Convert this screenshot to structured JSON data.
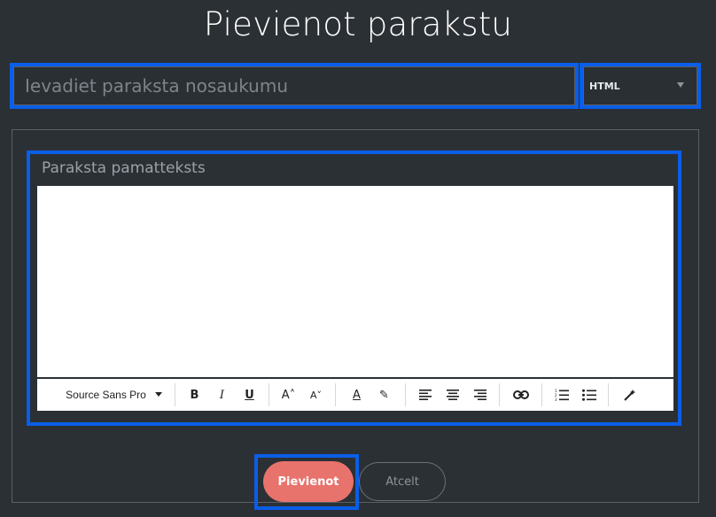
{
  "modal": {
    "title": "Pievienot parakstu",
    "name_placeholder": "Ievadiet paraksta nosaukumu",
    "name_value": "",
    "format_value": "HTML",
    "editor_label": "Paraksta pamatteksts",
    "toolbar": {
      "font_family": "Source Sans Pro",
      "bold": "B",
      "italic": "I",
      "underline": "U",
      "font_size_up": "A˄",
      "font_size_down": "A˅",
      "text_color": "A",
      "highlight": "✎",
      "align_left": "≡",
      "align_center": "≡",
      "align_right": "≡",
      "link": "⊂⊃",
      "ordered_list": "1≡",
      "unordered_list": "•≡",
      "clear_format": "✐"
    },
    "add_label": "Pievienot",
    "cancel_label": "Atcelt"
  },
  "colors": {
    "accent_border": "#0a5ee8",
    "primary_button": "#e8736c",
    "background": "#2b3035"
  }
}
